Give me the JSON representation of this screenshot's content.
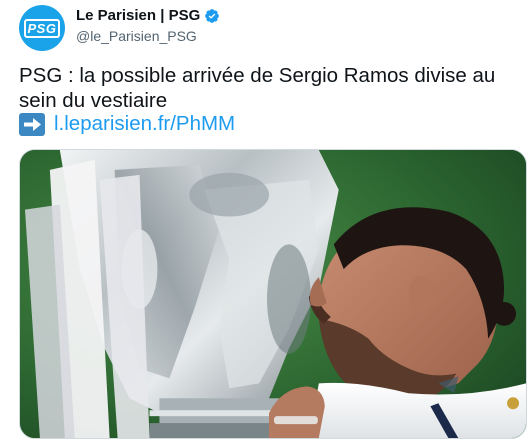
{
  "account": {
    "avatar_text": "PSG",
    "display_name": "Le Parisien | PSG",
    "handle": "@le_Parisien_PSG",
    "verified": true
  },
  "tweet": {
    "text": "PSG : la possible arrivée de Sergio Ramos divise au sein du vestiaire",
    "link_text": "l.leparisien.fr/PhMM",
    "link_prefix_icon": "right-arrow-emoji-icon"
  },
  "media": {
    "icon": "trophy-kiss-photo"
  },
  "colors": {
    "accent": "#1d9bf0",
    "avatar_bg": "#1aa3e8",
    "verified": "#1d9bf0",
    "arrow_emoji_bg": "#3b88c3",
    "text": "#0f1419",
    "secondary_text": "#536471"
  }
}
